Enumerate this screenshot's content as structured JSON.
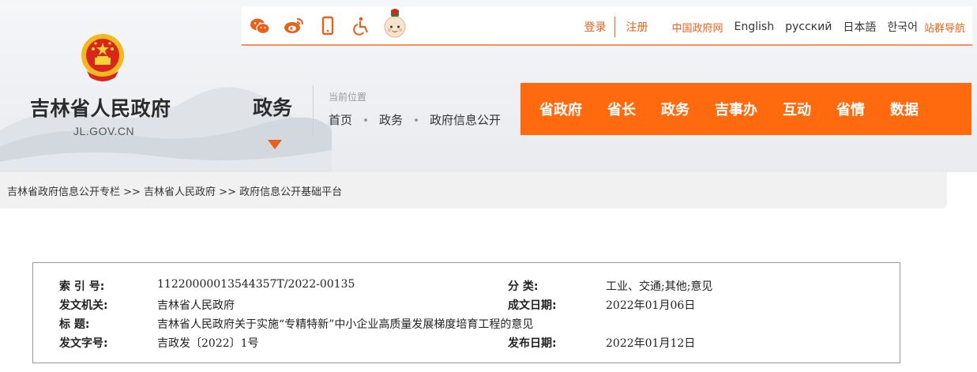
{
  "site": {
    "title": "吉林省人民政府",
    "domain": "JL.GOV.CN"
  },
  "topbar": {
    "icons": [
      "wechat-icon",
      "weibo-icon",
      "mobile-icon",
      "accessibility-icon",
      "mascot-icon"
    ],
    "login": "登录",
    "register": "注册",
    "links": [
      "中国政府网",
      "English",
      "русский",
      "日本語",
      "한국어",
      "站群导航"
    ]
  },
  "section": {
    "name": "政务"
  },
  "location": {
    "label": "当前位置",
    "path": [
      "首页",
      "政务",
      "政府信息公开"
    ]
  },
  "nav": {
    "items": [
      "省政府",
      "省长",
      "政务",
      "吉事办",
      "互动",
      "省情",
      "数据"
    ]
  },
  "breadcrumb": "吉林省政府信息公开专栏 >> 吉林省人民政府 >> 政府信息公开基础平台",
  "info": {
    "index_label": "索 引 号:",
    "index_value": "11220000013544357T/2022-00135",
    "category_label": "分    类:",
    "category_value": "工业、交通;其他;意见",
    "issuer_label": "发文机关:",
    "issuer_value": "吉林省人民政府",
    "written_label": "成文日期:",
    "written_value": "2022年01月06日",
    "title_label": "标      题:",
    "title_value": "吉林省人民政府关于实施“专精特新”中小企业高质量发展梯度培育工程的意见",
    "docno_label": "发文字号:",
    "docno_value": "吉政发〔2022〕1号",
    "published_label": "发布日期:",
    "published_value": "2022年01月12日"
  },
  "colors": {
    "accent": "#ff6a0e",
    "link_orange": "#e8611b",
    "breadcrumb_bg": "#f1f1f1"
  }
}
